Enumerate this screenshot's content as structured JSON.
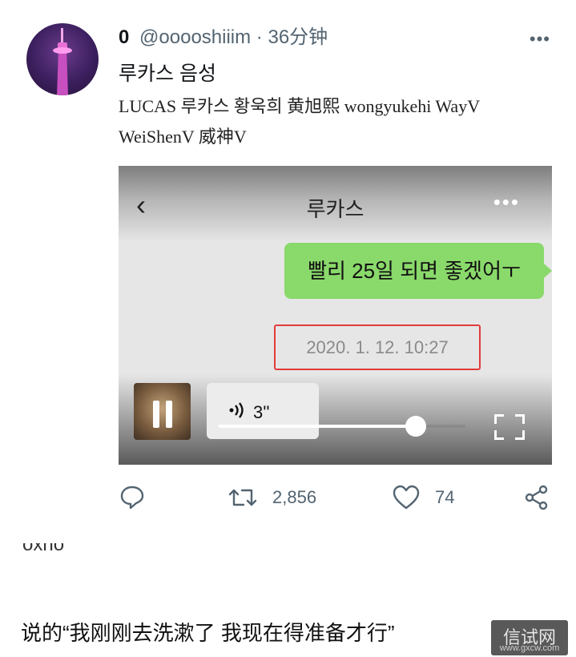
{
  "tweet": {
    "display_name": "0",
    "handle": "@ooooshiiim",
    "separator": "·",
    "time": "36分钟",
    "more_icon": "more-horizontal-icon",
    "text_line1": "루카스 음성",
    "text_line2": "LUCAS 루카스 황욱희 黄旭熙 wongyukehi WayV WeiShenV 威神V"
  },
  "media": {
    "chat_title": "루카스",
    "back_icon": "chevron-left-icon",
    "more_icon": "more-horizontal-icon",
    "bubble_text": "빨리 25일 되면 좋겠어ㅜ",
    "timestamp": "2020. 1. 12. 10:27",
    "voice_length": "3''",
    "playback_progress": 0.8,
    "highlight_color": "#e23b3b",
    "bubble_color": "#8ad96b"
  },
  "actions": {
    "reply_icon": "reply-icon",
    "retweet_icon": "retweet-icon",
    "retweet_count": "2,856",
    "like_icon": "heart-icon",
    "like_count": "74",
    "share_icon": "share-icon"
  },
  "below": {
    "cut_text": "oxho",
    "caption": "说的“我刚刚去洗漱了 我现在得准备才行”",
    "watermark": "信试网",
    "watermark_url": "www.gxcw.com"
  }
}
